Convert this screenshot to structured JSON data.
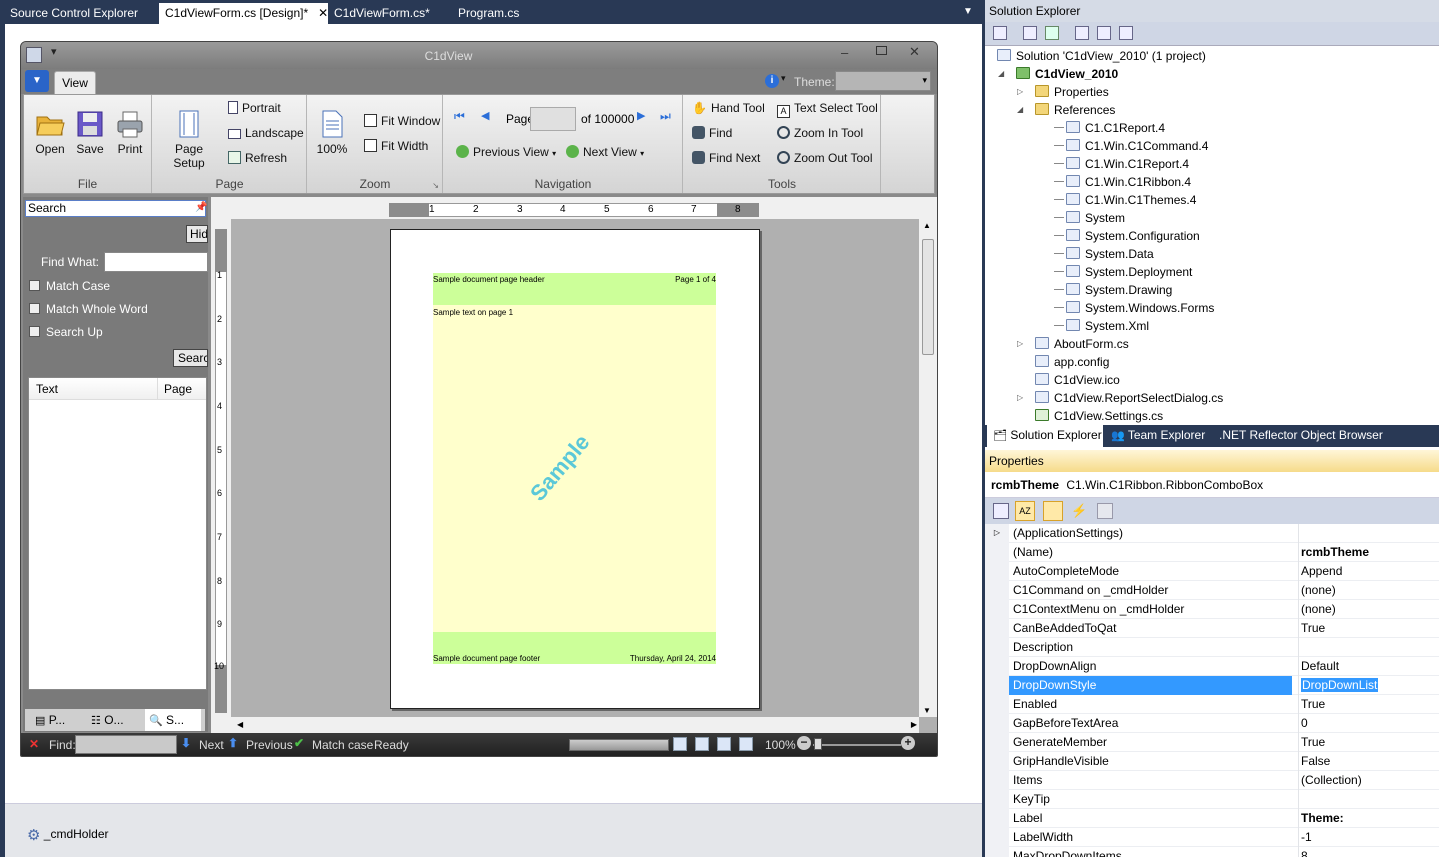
{
  "doc_tabs": [
    {
      "label": "Source Control Explorer"
    },
    {
      "label": "C1dViewForm.cs [Design]*"
    },
    {
      "label": "C1dViewForm.cs*"
    },
    {
      "label": "Program.cs"
    }
  ],
  "form": {
    "title": "C1dView",
    "ribbon_tab": "View",
    "theme_label": "Theme:",
    "groups": {
      "file": {
        "label": "File",
        "open": "Open",
        "save": "Save",
        "print": "Print"
      },
      "page": {
        "label": "Page",
        "page_setup": "Page Setup",
        "portrait": "Portrait",
        "landscape": "Landscape",
        "refresh": "Refresh"
      },
      "zoom": {
        "label": "Zoom",
        "zoom_value": "100%",
        "fit_window": "Fit Window",
        "fit_width": "Fit Width"
      },
      "navigation": {
        "label": "Navigation",
        "page_label": "Page",
        "of_pages": "of 100000",
        "previous_view": "Previous View",
        "next_view": "Next View"
      },
      "tools": {
        "label": "Tools",
        "hand_tool": "Hand Tool",
        "text_select_tool": "Text Select Tool",
        "find": "Find",
        "zoom_in_tool": "Zoom In Tool",
        "find_next": "Find Next",
        "zoom_out_tool": "Zoom Out Tool"
      }
    },
    "search_panel": {
      "title": "Search",
      "hide_button": "Hide",
      "find_what_label": "Find What:",
      "match_case": "Match Case",
      "match_whole_word": "Match Whole Word",
      "search_up": "Search Up",
      "search_button": "Search",
      "col_text": "Text",
      "col_page": "Page",
      "bottom_tabs": [
        "P...",
        "O...",
        "S..."
      ]
    },
    "ruler_h": [
      "1",
      "2",
      "3",
      "4",
      "5",
      "6",
      "7",
      "8"
    ],
    "ruler_v": [
      "1",
      "2",
      "3",
      "4",
      "5",
      "6",
      "7",
      "8",
      "9",
      "10"
    ],
    "page": {
      "header_left": "Sample document page header",
      "header_right": "Page 1 of 4",
      "body_text": "Sample text on page 1",
      "watermark": "Sample",
      "footer_left": "Sample document page footer",
      "footer_right": "Thursday, April 24, 2014"
    },
    "status": {
      "find_label": "Find:",
      "next": "Next",
      "previous": "Previous",
      "match_case": "Match case",
      "state": "Ready",
      "zoom": "100%"
    }
  },
  "component_tray": {
    "item": "_cmdHolder"
  },
  "solution_explorer": {
    "title": "Solution Explorer",
    "tree": [
      {
        "label": "Solution 'C1dView_2010' (1 project)",
        "level": 0,
        "icon": "solution-icon"
      },
      {
        "label": "C1dView_2010",
        "level": 1,
        "icon": "project-icon",
        "bold": true
      },
      {
        "label": "Properties",
        "level": 2,
        "icon": "properties-folder-icon"
      },
      {
        "label": "References",
        "level": 2,
        "icon": "folder-icon"
      },
      {
        "label": "C1.C1Report.4",
        "level": 3,
        "icon": "reference-icon"
      },
      {
        "label": "C1.Win.C1Command.4",
        "level": 3,
        "icon": "reference-icon"
      },
      {
        "label": "C1.Win.C1Report.4",
        "level": 3,
        "icon": "reference-icon"
      },
      {
        "label": "C1.Win.C1Ribbon.4",
        "level": 3,
        "icon": "reference-icon"
      },
      {
        "label": "C1.Win.C1Themes.4",
        "level": 3,
        "icon": "reference-icon"
      },
      {
        "label": "System",
        "level": 3,
        "icon": "reference-icon"
      },
      {
        "label": "System.Configuration",
        "level": 3,
        "icon": "reference-icon"
      },
      {
        "label": "System.Data",
        "level": 3,
        "icon": "reference-icon"
      },
      {
        "label": "System.Deployment",
        "level": 3,
        "icon": "reference-icon"
      },
      {
        "label": "System.Drawing",
        "level": 3,
        "icon": "reference-icon"
      },
      {
        "label": "System.Windows.Forms",
        "level": 3,
        "icon": "reference-icon"
      },
      {
        "label": "System.Xml",
        "level": 3,
        "icon": "reference-icon"
      },
      {
        "label": "AboutForm.cs",
        "level": 2,
        "icon": "form-icon"
      },
      {
        "label": "app.config",
        "level": 2,
        "icon": "config-icon"
      },
      {
        "label": "C1dView.ico",
        "level": 2,
        "icon": "icon-file-icon"
      },
      {
        "label": "C1dView.ReportSelectDialog.cs",
        "level": 2,
        "icon": "form-icon"
      },
      {
        "label": "C1dView.Settings.cs",
        "level": 2,
        "icon": "cs-file-icon"
      }
    ],
    "tabs": [
      "Solution Explorer",
      "Team Explorer",
      ".NET Reflector Object Browser"
    ]
  },
  "properties": {
    "title": "Properties",
    "object_name": "rcmbTheme",
    "object_type": "C1.Win.C1Ribbon.RibbonComboBox",
    "rows": [
      {
        "name": "(ApplicationSettings)",
        "value": ""
      },
      {
        "name": "(Name)",
        "value": "rcmbTheme"
      },
      {
        "name": "AutoCompleteMode",
        "value": "Append"
      },
      {
        "name": "C1Command on _cmdHolder",
        "value": "(none)"
      },
      {
        "name": "C1ContextMenu on _cmdHolder",
        "value": "(none)"
      },
      {
        "name": "CanBeAddedToQat",
        "value": "True"
      },
      {
        "name": "Description",
        "value": ""
      },
      {
        "name": "DropDownAlign",
        "value": "Default"
      },
      {
        "name": "DropDownStyle",
        "value": "DropDownList"
      },
      {
        "name": "Enabled",
        "value": "True"
      },
      {
        "name": "GapBeforeTextArea",
        "value": "0"
      },
      {
        "name": "GenerateMember",
        "value": "True"
      },
      {
        "name": "GripHandleVisible",
        "value": "False"
      },
      {
        "name": "Items",
        "value": "(Collection)"
      },
      {
        "name": "KeyTip",
        "value": ""
      },
      {
        "name": "Label",
        "value": "Theme:"
      },
      {
        "name": "LabelWidth",
        "value": "-1"
      },
      {
        "name": "MaxDropDownItems",
        "value": "8"
      }
    ]
  },
  "colors": {
    "vs_dark": "#293955",
    "selection": "#3399ff",
    "band_green": "#ccff99",
    "page_body": "#ffffcc",
    "watermark": "#5bc8d8"
  }
}
